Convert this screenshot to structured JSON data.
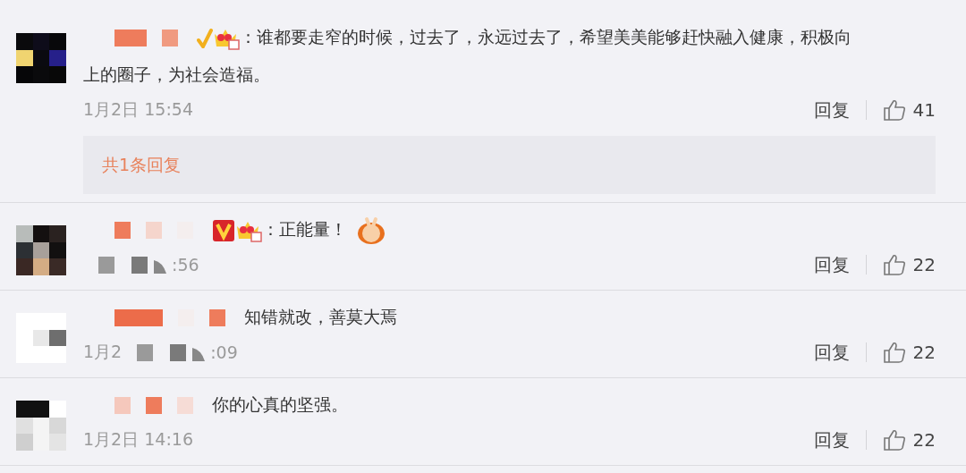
{
  "comments": [
    {
      "lines": [
        "：谁都要走窄的时候，过去了，永远过去了，希望美美能够赶快融入健康，积极向",
        "上的圈子，为社会造福。"
      ],
      "time": [
        {
          "kind": "text",
          "text": "1月2日 15:54"
        }
      ],
      "reply_label": "回复",
      "likes": "41",
      "replies_link": "共1条回复"
    },
    {
      "lines": [
        "：正能量！"
      ],
      "time": [
        {
          "kind": "mosaic"
        },
        {
          "kind": "text",
          "text": ":56"
        }
      ],
      "reply_label": "回复",
      "likes": "22"
    },
    {
      "lines": [
        "知错就改，善莫大焉"
      ],
      "time": [
        {
          "kind": "text",
          "text": "1月2"
        },
        {
          "kind": "mosaic"
        },
        {
          "kind": "text",
          "text": ":09"
        }
      ],
      "reply_label": "回复",
      "likes": "22"
    },
    {
      "lines": [
        "你的心真的坚强。"
      ],
      "time": [
        {
          "kind": "text",
          "text": "1月2日 14:16"
        }
      ],
      "reply_label": "回复",
      "likes": "22"
    }
  ]
}
